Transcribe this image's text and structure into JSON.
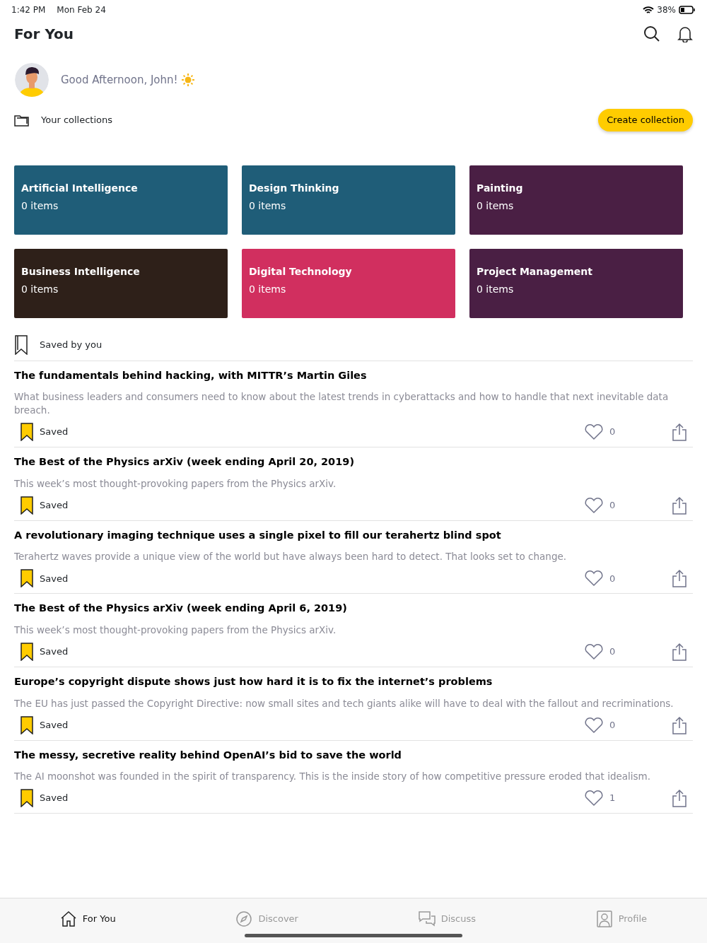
{
  "status_bar": {
    "time": "1:42 PM",
    "date": "Mon Feb 24",
    "battery": "38%"
  },
  "header": {
    "title": "For You"
  },
  "greeting": "Good Afternoon, John!",
  "collections_header": {
    "label": "Your collections",
    "button": "Create collection"
  },
  "collections": [
    {
      "name": "Artificial Intelligence",
      "count": "0 items",
      "color": "#1f5d78"
    },
    {
      "name": "Design Thinking",
      "count": "0 items",
      "color": "#1f5d78"
    },
    {
      "name": "Painting",
      "count": "0 items",
      "color": "#4a1f44"
    },
    {
      "name": "Business Intelligence",
      "count": "0 items",
      "color": "#2e2019"
    },
    {
      "name": "Digital Technology",
      "count": "0 items",
      "color": "#d12f5f"
    },
    {
      "name": "Project Management",
      "count": "0 items",
      "color": "#4a1f44"
    }
  ],
  "saved_section": {
    "title": "Saved by you"
  },
  "articles": [
    {
      "title": "The fundamentals behind hacking, with MITTR’s Martin Giles",
      "description": "What business leaders and consumers need to know about the latest trends in cyberattacks and how to handle that next inevitable data breach.",
      "saved": true,
      "saved_label": "Saved",
      "likes": "0"
    },
    {
      "title": "The Best of the Physics arXiv (week ending April 20, 2019)",
      "description": "This week’s most thought-provoking papers from the Physics arXiv.",
      "saved": true,
      "saved_label": "Saved",
      "likes": "0"
    },
    {
      "title": "A revolutionary imaging technique uses a single pixel to fill our terahertz blind spot",
      "description": "Terahertz waves provide a unique view of the world but have always been hard to detect. That looks set to change.",
      "saved": true,
      "saved_label": "Saved",
      "likes": "0"
    },
    {
      "title": "The Best of the Physics arXiv (week ending April 6, 2019)",
      "description": "This week’s most thought-provoking papers from the Physics arXiv.",
      "saved": true,
      "saved_label": "Saved",
      "likes": "0"
    },
    {
      "title": "Europe’s copyright dispute shows just how hard it is to fix the internet’s problems",
      "description": "The EU has just passed the Copyright Directive: now small sites and tech giants alike will have to deal with the fallout and recriminations.",
      "saved": true,
      "saved_label": "Saved",
      "likes": "0"
    },
    {
      "title": "The messy, secretive reality behind OpenAI’s bid to save the world",
      "description": "The AI moonshot was founded in the spirit of transparency. This is the inside story of how competitive pressure eroded that idealism.",
      "saved": true,
      "saved_label": "Saved",
      "likes": "1"
    }
  ],
  "tabs": [
    {
      "label": "For You",
      "kind": "home",
      "selected": true
    },
    {
      "label": "Discover",
      "kind": "compass",
      "selected": false
    },
    {
      "label": "Discuss",
      "kind": "chat",
      "selected": false
    },
    {
      "label": "Profile",
      "kind": "person",
      "selected": false
    }
  ]
}
